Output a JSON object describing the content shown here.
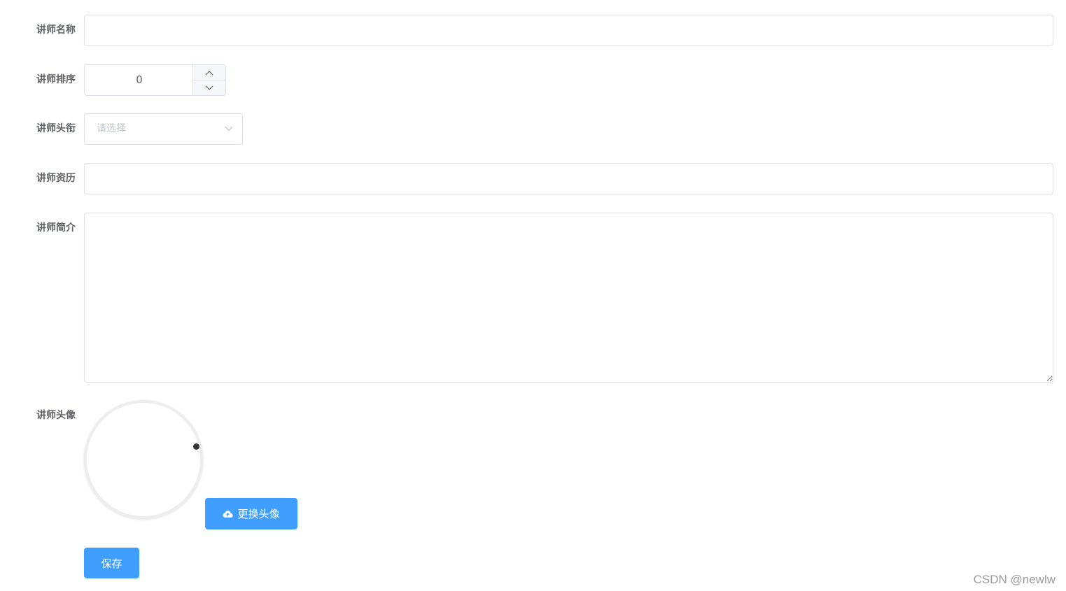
{
  "form": {
    "name_label": "讲师名称",
    "name_value": "",
    "sort_label": "讲师排序",
    "sort_value": "0",
    "title_label": "讲师头衔",
    "title_placeholder": "请选择",
    "career_label": "讲师资历",
    "career_value": "",
    "intro_label": "讲师简介",
    "intro_value": "",
    "avatar_label": "讲师头像",
    "change_avatar_label": "更换头像",
    "save_label": "保存"
  },
  "icons": {
    "stepper_up": "chevron-up-icon",
    "stepper_down": "chevron-down-icon",
    "select_arrow": "chevron-down-icon",
    "upload": "cloud-upload-icon"
  },
  "colors": {
    "primary": "#409eff",
    "label": "#606266",
    "border": "#dcdfe6",
    "placeholder": "#c0c4cc"
  },
  "watermark": "CSDN @newlw"
}
